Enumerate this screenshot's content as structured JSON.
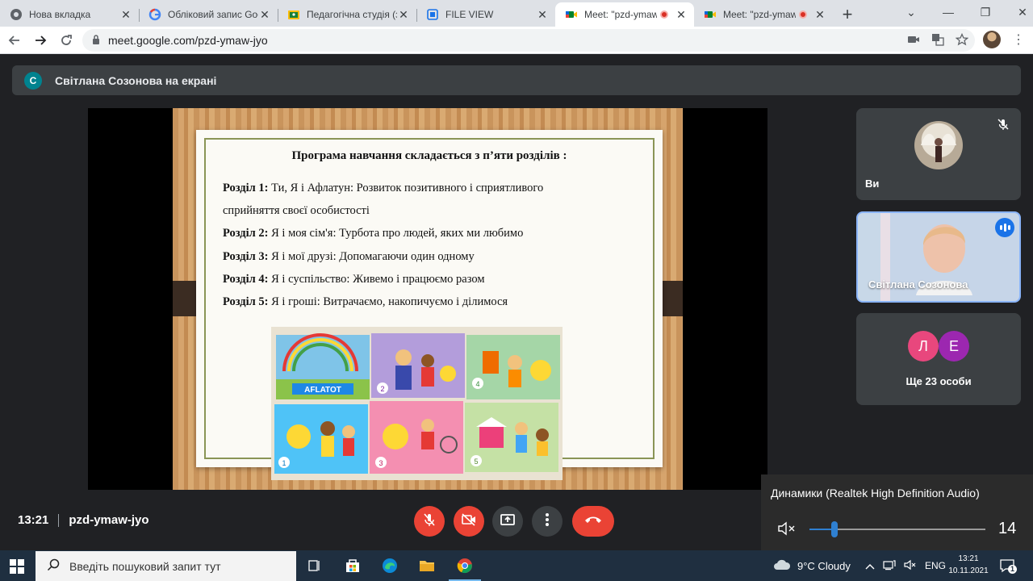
{
  "browser": {
    "tabs": [
      {
        "title": "Нова вкладка",
        "icon": "chrome-icon",
        "active": false
      },
      {
        "title": "Обліковий запис Goo",
        "icon": "google-icon",
        "active": false
      },
      {
        "title": "Педагогічна студія (з",
        "icon": "classroom-icon",
        "active": false
      },
      {
        "title": "FILE VIEW",
        "icon": "file-icon",
        "active": false
      },
      {
        "title": "Meet: \"pzd-ymaw",
        "icon": "meet-icon",
        "active": true,
        "recording": true
      },
      {
        "title": "Meet: \"pzd-ymaw",
        "icon": "meet-icon",
        "active": false,
        "recording": true
      }
    ],
    "url": "meet.google.com/pzd-ymaw-jyo"
  },
  "meet": {
    "presenter_avatar_letter": "С",
    "presenter_banner": "Світлана Созонова на екрані",
    "slide": {
      "title": "Програма навчання складається з п’яти розділів :",
      "sections": [
        {
          "label": "Розділ 1:",
          "text": "Ти, Я і Афлатун: Розвиток позитивного і сприятливого"
        },
        {
          "label": "",
          "text": "сприйняття своєї особистості"
        },
        {
          "label": "Розділ 2:",
          "text": "Я і моя сім'я: Турбота про людей, яких ми любимо"
        },
        {
          "label": "Розділ 3:",
          "text": "Я і мої друзі: Допомагаючи один одному"
        },
        {
          "label": "Розділ 4:",
          "text": "Я і суспільство: Живемо і працюємо разом"
        },
        {
          "label": "Розділ 5:",
          "text": "Я і гроші: Витрачаємо, накопичуємо і ділимося"
        }
      ],
      "photo_cards": [
        "AFLATOT",
        "2",
        "4",
        "1",
        "3",
        "5"
      ]
    },
    "participants": {
      "you_label": "Ви",
      "speaker_name": "Світлана Созонова",
      "others_letters": [
        "Л",
        "Е"
      ],
      "others_colors": [
        "#e8477d",
        "#9c27b0"
      ],
      "others_text": "Ще 23 особи"
    },
    "time": "13:21",
    "meeting_code": "pzd-ymaw-jyo",
    "controls": [
      "mic-off",
      "camera-off",
      "present",
      "more",
      "hang-up"
    ]
  },
  "volume_flyout": {
    "device": "Динамики (Realtek High Definition Audio)",
    "level": 14,
    "level_fraction": 0.14
  },
  "taskbar": {
    "search_placeholder": "Введіть пошуковий запит тут",
    "weather": "9°C  Cloudy",
    "language": "ENG",
    "clock_time": "13:21",
    "clock_date": "10.11.2021",
    "notification_count": "1"
  },
  "colors": {
    "meet_bg": "#202124",
    "tile_bg": "#3c4043",
    "danger": "#ea4335",
    "accent": "#8ab4f8",
    "taskbar": "#1f2f40"
  }
}
